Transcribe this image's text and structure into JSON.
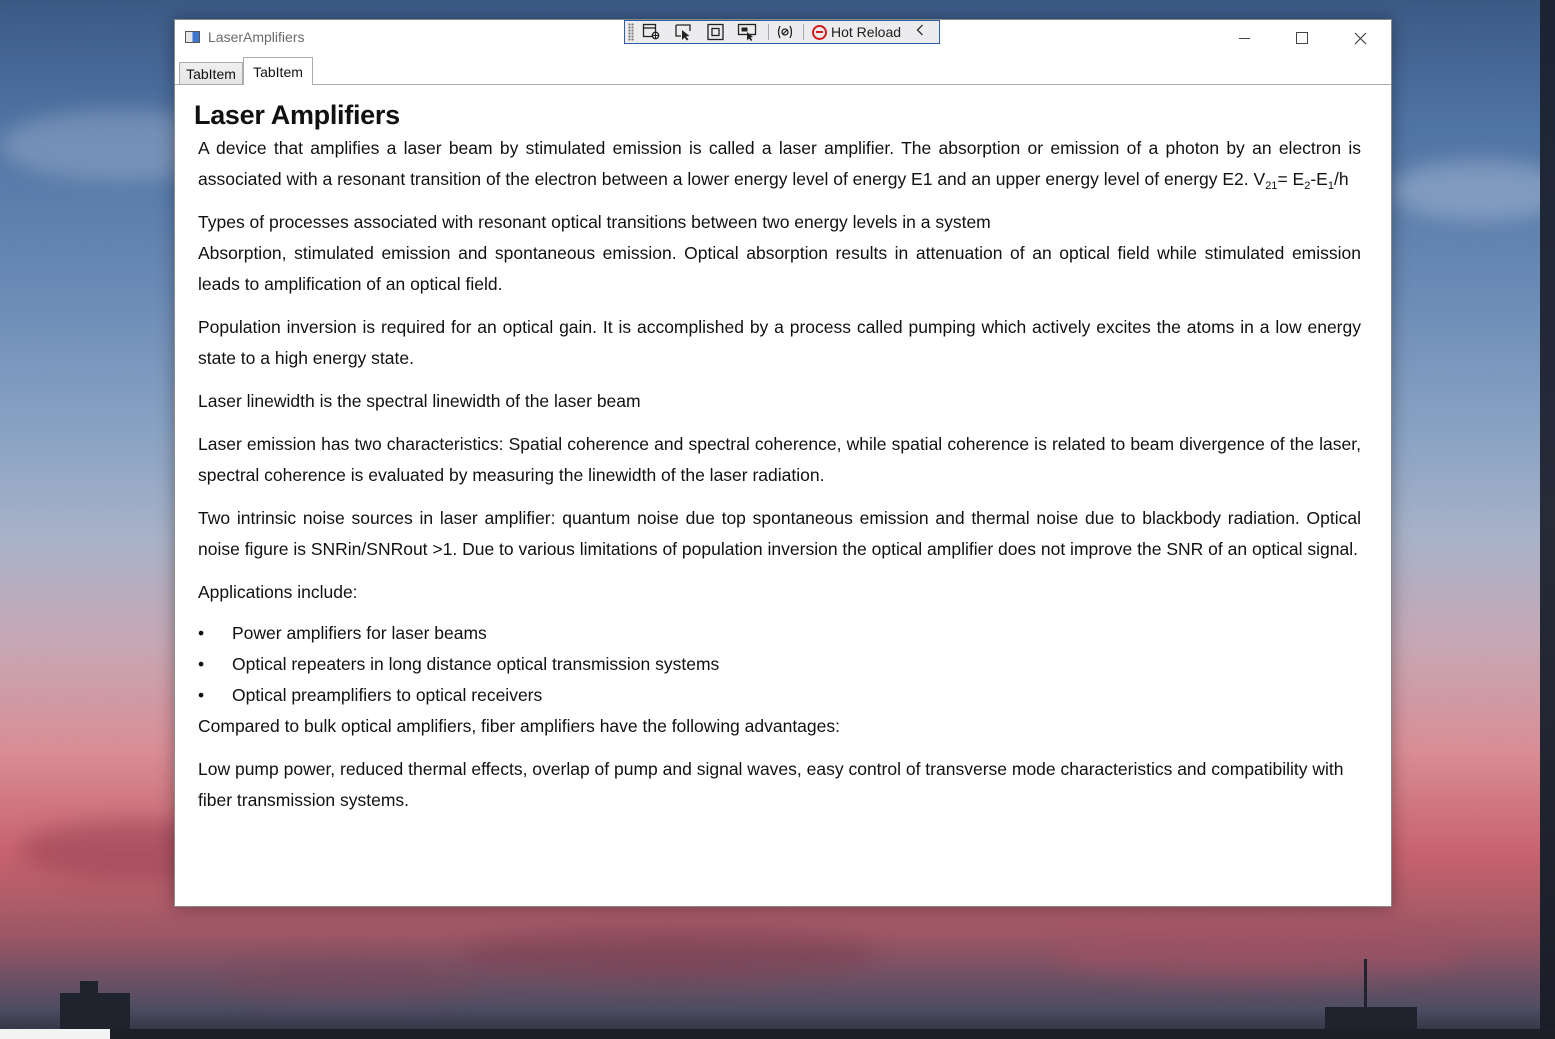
{
  "window": {
    "title": "LaserAmplifiers"
  },
  "debug_toolbar": {
    "hot_reload_label": "Hot Reload",
    "icons": [
      "select-element-icon",
      "select-pointer-icon",
      "layout-adorner-icon",
      "track-focus-icon",
      "binding-failures-icon"
    ]
  },
  "tabs": [
    {
      "label": "TabItem",
      "selected": false
    },
    {
      "label": "TabItem",
      "selected": true
    }
  ],
  "doc": {
    "heading": "Laser Amplifiers",
    "p1": {
      "text": "A device that amplifies a laser beam by stimulated emission is called a laser amplifier. The absorption or emission of a photon by an electron is associated with a resonant transition of the electron between a lower energy level of energy E1 and an upper energy level of energy E2.  V",
      "v_sub": "21",
      "eq": "=",
      "e_a": "E",
      "e_a_sub": "2",
      "minus": "-E",
      "e_b_sub": "1",
      "tail": "/h"
    },
    "p2": "Types of processes associated with resonant optical transitions between two energy levels in a system",
    "p3": "Absorption, stimulated emission and spontaneous emission.  Optical absorption results in attenuation of an optical field while stimulated emission leads to amplification of an optical field.",
    "p4": "Population inversion is required for an optical gain. It is accomplished by a process called pumping which actively excites the atoms in a  low energy state to a high energy state.",
    "p5": "Laser linewidth is the spectral linewidth of the laser beam",
    "p6": "Laser emission has two characteristics: Spatial coherence and spectral coherence, while spatial coherence is related to beam divergence of the laser, spectral coherence is evaluated by measuring the linewidth of the laser radiation.",
    "p7": "Two intrinsic noise sources in laser amplifier: quantum noise due top spontaneous emission and thermal noise due to blackbody radiation. Optical noise figure is SNRin/SNRout >1.  Due to various limitations of population inversion the optical amplifier does not improve the SNR of an optical signal.",
    "p8": "Applications include:",
    "bullet_glyph": "•",
    "applications": [
      "Power amplifiers for laser beams",
      "Optical repeaters in long distance optical transmission systems",
      "Optical preamplifiers to optical receivers"
    ],
    "p9": "Compared to bulk optical amplifiers, fiber amplifiers have the following advantages:",
    "p10": "Low pump power, reduced thermal effects, overlap of pump and signal waves, easy control of transverse mode characteristics and compatibility with fiber transmission systems."
  }
}
